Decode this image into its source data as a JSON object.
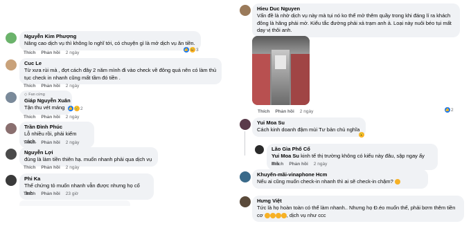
{
  "left": [
    {
      "name": "Nguyễn Kim Phượng",
      "text": "Nâng cao dịch vụ thì không lo nghĩ tới, có chuyện gì là mở dịch vụ ăn tiền.",
      "like": "Thích",
      "reply": "Phản hồi",
      "time": "2 ngày",
      "reactions": "3"
    },
    {
      "name": "Cuc Le",
      "text": "Từ xưa rùi mà , đợt cách đây 2 năm mình đi vào check về đông quá nên có làm thủ tục check in nhanh cũng mất tầm đó tiền .",
      "like": "Thích",
      "reply": "Phản hồi",
      "time": "2 ngày"
    },
    {
      "badge": "Fan cứng",
      "name": "Giáp Nguyễn Xuân",
      "text": "Tận thu vét máng",
      "like": "Thích",
      "reply": "Phản hồi",
      "time": "2 ngày",
      "reactions": "2"
    },
    {
      "name": "Trần Đình Phúc",
      "text": "Lỗ nhiều rồi, phải kiếm cách.",
      "like": "Thích",
      "reply": "Phản hồi",
      "time": "2 ngày"
    },
    {
      "name": "Nguyễn Lợi",
      "text": "đúng là làm tiền thiên hạ. muốn nhanh phải qua dịch vụ",
      "like": "Thích",
      "reply": "Phản hồi",
      "time": "2 ngày"
    },
    {
      "name": "Phi Ka",
      "text": "Thế chứng tỏ muốn nhanh vẫn được nhưng họ cố tình",
      "like": "Thích",
      "reply": "Phản hồi",
      "time": "23 giờ"
    }
  ],
  "right": [
    {
      "name": "Hieu Duc Nguyen",
      "text": "Vấn đề là nhờ dịch vụ này mà tụi nó ko thể mở thêm quầy trong khi đáng lí ra khách đông là hãng phải mở. Kiểu tắc đường phải xả trạm anh ả. Loại này nuôi béo tụi mất dạy vị thôi anh.",
      "like": "Thích",
      "reply": "Phản hồi",
      "time": "2 ngày",
      "reactions": "2"
    },
    {
      "name": "Yui Moa Su",
      "text": "Cách kinh doanh đậm mùi Tư bản chủ nghĩa",
      "like": "Thích",
      "reply": "Phản hồi",
      "time": "2 ngày"
    },
    {
      "name": "Lão Gìa Phố Cổ",
      "mention": "Yui Moa Su",
      "text": "kinh tế thị trường không có kiểu này đâu, sập ngay ấy mà",
      "like": "Thích",
      "reply": "Phản hồi",
      "time": "2 ngày"
    },
    {
      "name": "Khuyến-mãi-vinaphone Hcm",
      "text": "Nếu ai cũng muốn check-in nhanh thì ai sẽ check-in chậm?",
      "like": "Thích",
      "reply": "Phản hồi",
      "time": "2 ngày"
    },
    {
      "name": "Hưng Việt",
      "text": "Tức là họ hoàn toàn có thể làm nhanh.. Nhưng họ Đ.éo muốn thế, phải bơm thêm tiền cơ",
      "text2": ", dịch vụ như ccc",
      "like": "Thích",
      "reply": "Phản hồi",
      "time": "2 ngày"
    }
  ],
  "colors": {
    "like": "#1877f2",
    "haha": "#f7b125",
    "bubble": "#f0f2f5",
    "meta": "#65676b"
  }
}
